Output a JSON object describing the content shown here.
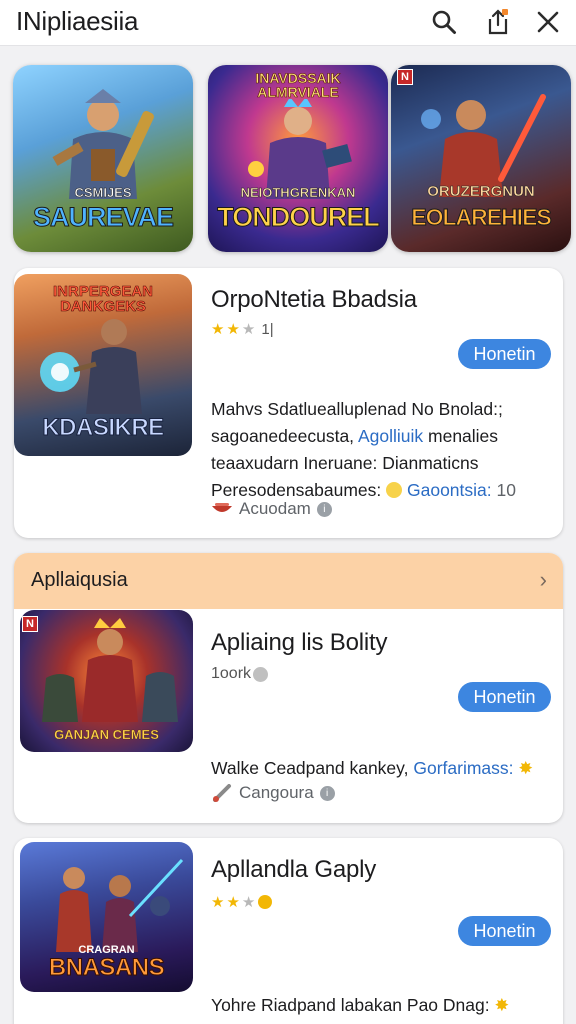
{
  "header": {
    "title": "INipliaesiia",
    "icons": [
      "search-icon",
      "share-icon",
      "close-icon"
    ]
  },
  "featured": [
    {
      "top": "",
      "sub": "CSMIJES",
      "caption": "SAUREVAE",
      "caption_color": "#4fb3ff"
    },
    {
      "top": "INAVDSSAIK\nALMRVIALE",
      "sub": "NEIOTHGRENKAN",
      "caption": "TONDOUREL",
      "caption_color": "#ffd24a"
    },
    {
      "top": "",
      "badge": "N",
      "sub": "ORUZERGNUN",
      "caption": "EOLAREHIES",
      "caption_color": "#ffb23a"
    }
  ],
  "cards": [
    {
      "title": "OrpoNtetia Bbadsia",
      "rating_suffix": "1|",
      "button": "Honetin",
      "thumb_top": "INRPERGEAN\nDANKGEKS",
      "thumb_caption": "KDASIKRE",
      "desc": [
        "Mahvs Sdatluealluplenad  No Bnolad:;",
        "sagoanedeecusta,",
        "teaaxudarn Ineruane: Dianmaticns",
        "Peresodensabaumes:"
      ],
      "desc_link_1": "Agolliuik",
      "desc_tail_1": " menalies",
      "desc_link_2": "Gaoontsia:",
      "desc_tail_2": " 10",
      "meta_label": "Acuodam"
    },
    {
      "section": "Apllaiqusia",
      "title": "Apliaing lis Bolity",
      "rating_text": "1oork",
      "button": "Honetin",
      "thumb_caption": "GANJAN CEMES",
      "thumb_badge": "N",
      "desc": [
        "Walke Ceadpand kankey,"
      ],
      "desc_link_1": "Gorfarimass:",
      "meta_label": "Cangoura"
    },
    {
      "title": "Apllandla Gaply",
      "button": "Honetin",
      "thumb_top": "CRAGRAN",
      "thumb_caption": "BNASANS",
      "desc": [
        "Yohre Riadpand labakan Pao Dnag:"
      ]
    }
  ],
  "colors": {
    "accent": "#3d86e0",
    "section_header": "#fcd2a6",
    "link": "#2b6cc4",
    "star": "#f2b705"
  }
}
